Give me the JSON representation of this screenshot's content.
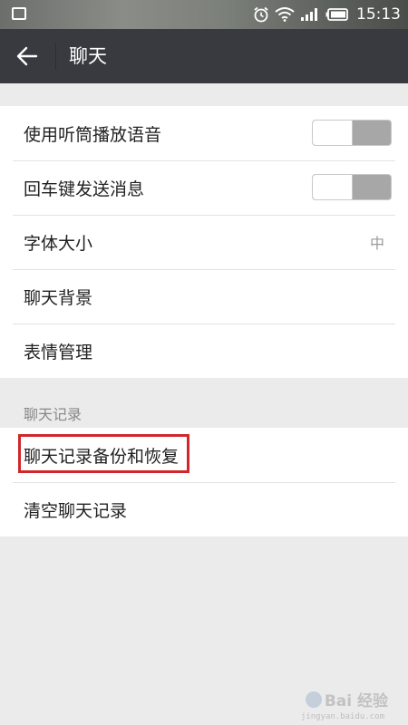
{
  "status_bar": {
    "time": "15:13",
    "icons": [
      "gallery-icon",
      "alarm-icon",
      "wifi-icon",
      "signal-icon",
      "battery-icon"
    ]
  },
  "header": {
    "title": "聊天",
    "back_icon": "back-arrow-icon"
  },
  "settings": {
    "items": [
      {
        "label": "使用听筒播放语音",
        "control": "toggle",
        "state": "off"
      },
      {
        "label": "回车键发送消息",
        "control": "toggle",
        "state": "off"
      },
      {
        "label": "字体大小",
        "value": "中"
      },
      {
        "label": "聊天背景"
      },
      {
        "label": "表情管理"
      }
    ]
  },
  "chat_records": {
    "section_title": "聊天记录",
    "items": [
      {
        "label": "聊天记录备份和恢复",
        "highlighted": true
      },
      {
        "label": "清空聊天记录"
      }
    ]
  },
  "watermark": {
    "text": "Bai 经验",
    "sub": "jingyan.baidu.com"
  },
  "colors": {
    "topbar": "#393a3f",
    "background": "#ebebeb",
    "highlight_border": "#d2262b"
  }
}
